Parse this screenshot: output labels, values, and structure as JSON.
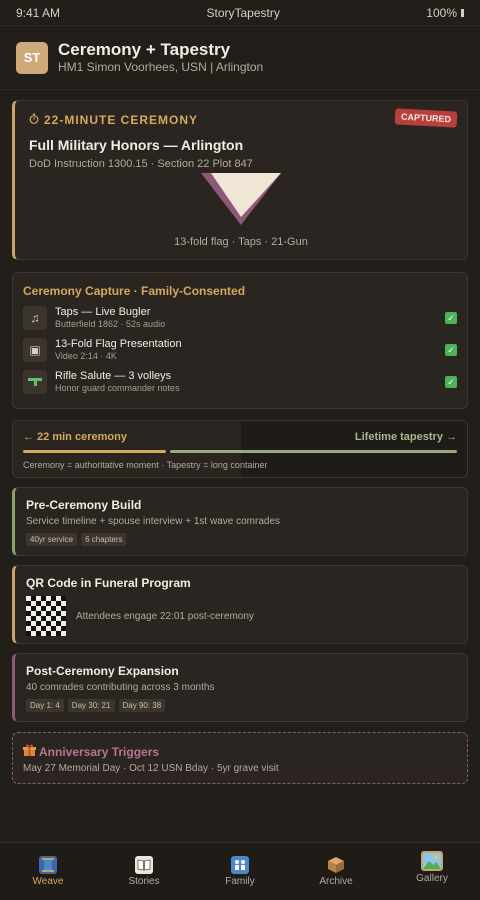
{
  "status": {
    "time": "9:41 AM",
    "app": "StoryTapestry",
    "battery": "100%"
  },
  "header": {
    "avatar": "ST",
    "title": "Ceremony + Tapestry",
    "subtitle": "HM1 Simon Voorhees, USN | Arlington"
  },
  "ceremony": {
    "label": "22-MINUTE CEREMONY",
    "badge": "CAPTURED",
    "title": "Full Military Honors — Arlington",
    "ref": "DoD Instruction 1300.15 · Section 22 Plot 847",
    "caption": "13-fold flag · Taps · 21-Gun",
    "colors": {
      "flag_light": "#efe6d6",
      "flag_dark": "#8c5a76"
    }
  },
  "capture": {
    "title": "Ceremony Capture · Family-Consented",
    "items": [
      {
        "icon": "trumpet-icon",
        "title": "Taps — Live Bugler",
        "sub": "Butterfield 1862 · 52s audio"
      },
      {
        "icon": "video-icon",
        "title": "13-Fold Flag Presentation",
        "sub": "Video 2:14 · 4K"
      },
      {
        "icon": "rifle-icon",
        "title": "Rifle Salute — 3 volleys",
        "sub": "Honor guard commander notes"
      }
    ]
  },
  "timeline": {
    "left": "← 22 min ceremony",
    "right": "Lifetime tapestry →",
    "note": "Ceremony = authoritative moment · Tapestry = long container"
  },
  "pre": {
    "title": "Pre-Ceremony Build",
    "sub": "Service timeline + spouse interview + 1st wave comrades",
    "tags": [
      "40yr service",
      "6 chapters"
    ]
  },
  "qr": {
    "title": "QR Code in Funeral Program",
    "text": "Attendees engage 22:01 post-ceremony"
  },
  "post": {
    "title": "Post-Ceremony Expansion",
    "sub": "40 comrades contributing across 3 months",
    "tags": [
      "Day 1: 4",
      "Day 30: 21",
      "Day 90: 38"
    ]
  },
  "anniversary": {
    "title": "Anniversary Triggers",
    "sub": "May 27 Memorial Day · Oct 12 USN Bday · 5yr grave visit"
  },
  "nav": [
    {
      "label": "Weave",
      "icon": "spool-icon",
      "active": true
    },
    {
      "label": "Stories",
      "icon": "book-icon"
    },
    {
      "label": "Family",
      "icon": "family-icon"
    },
    {
      "label": "Archive",
      "icon": "box-icon"
    },
    {
      "label": "Gallery",
      "icon": "picture-icon"
    }
  ]
}
